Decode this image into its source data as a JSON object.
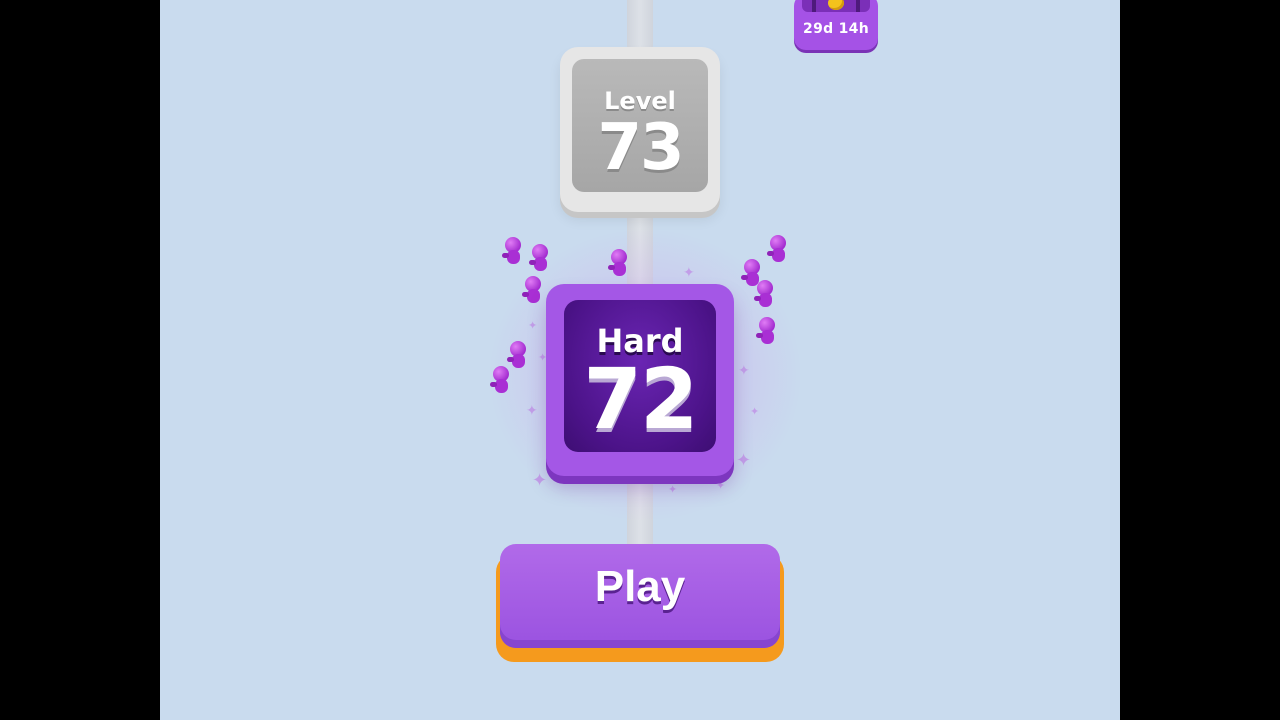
{
  "event": {
    "timer": "29d 14h",
    "icon": "treasure-chest-icon"
  },
  "levels": {
    "next": {
      "label": "Level",
      "number": "73",
      "state": "locked"
    },
    "current": {
      "label": "Hard",
      "number": "72",
      "state": "current"
    }
  },
  "play_button": {
    "label": "Play"
  },
  "colors": {
    "background": "#c9dbee",
    "accent_purple": "#a457e6",
    "button_orange": "#f59a1d",
    "locked_gray": "#b0b0b0",
    "crowd_purple": "#a92fd4"
  }
}
